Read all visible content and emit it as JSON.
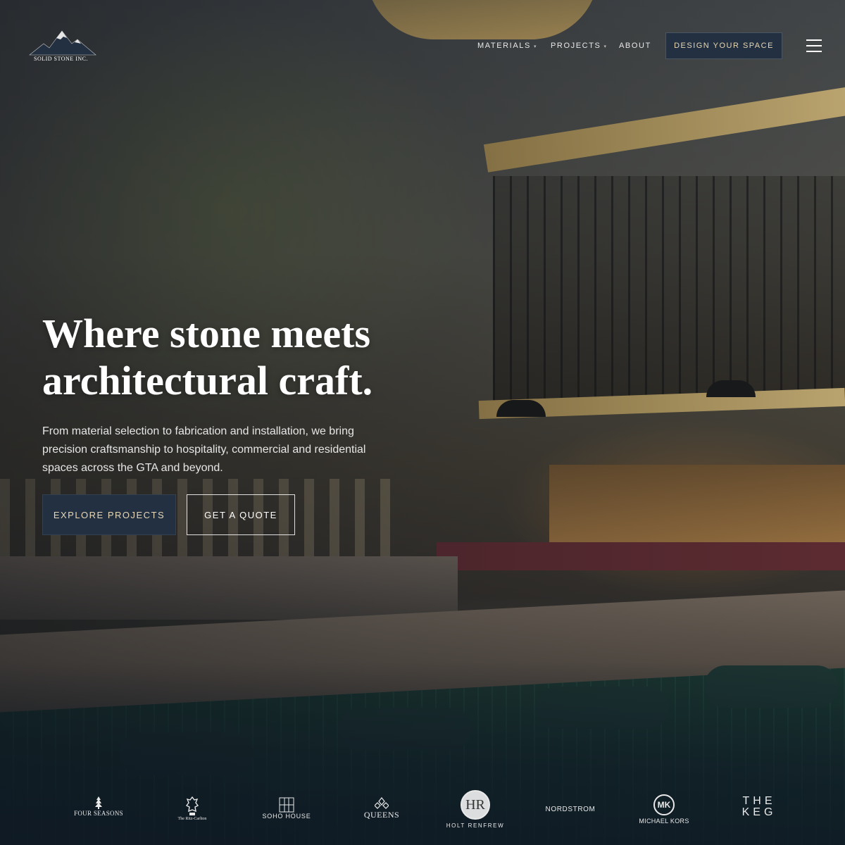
{
  "brand": {
    "name": "SOLID STONE INC.",
    "colors": {
      "navy": "#223041",
      "gold_text": "#e7d7b4",
      "white": "#ffffff"
    }
  },
  "nav": {
    "items": [
      {
        "label": "MATERIALS",
        "has_dropdown": true
      },
      {
        "label": "PROJECTS",
        "has_dropdown": true
      },
      {
        "label": "ABOUT",
        "has_dropdown": false
      }
    ],
    "caret": "▾",
    "cta_label": "DESIGN YOUR SPACE",
    "menu_icon": "hamburger-icon"
  },
  "hero": {
    "headline_line1": "Where stone meets",
    "headline_line2": "architectural craft.",
    "subcopy": "From material selection to fabrication and installation, we bring precision craftsmanship to hospitality, commercial and residential spaces across the GTA and beyond.",
    "primary_button": "EXPLORE PROJECTS",
    "secondary_button": "GET A QUOTE"
  },
  "clients": [
    {
      "name": "FOUR SEASONS",
      "icon": "four-seasons-tree-icon"
    },
    {
      "name": "The Ritz-Carlton",
      "icon": "ritz-carlton-lion-crest-icon"
    },
    {
      "name": "SOHO HOUSE",
      "icon": "soho-house-grid-icon"
    },
    {
      "name": "QUEENS",
      "icon": "queens-crown-icon"
    },
    {
      "name": "HOLT RENFREW",
      "monogram": "HR"
    },
    {
      "name": "NORDSTROM"
    },
    {
      "name": "MICHAEL KORS",
      "monogram": "MK"
    },
    {
      "name": "THE KEG"
    }
  ]
}
